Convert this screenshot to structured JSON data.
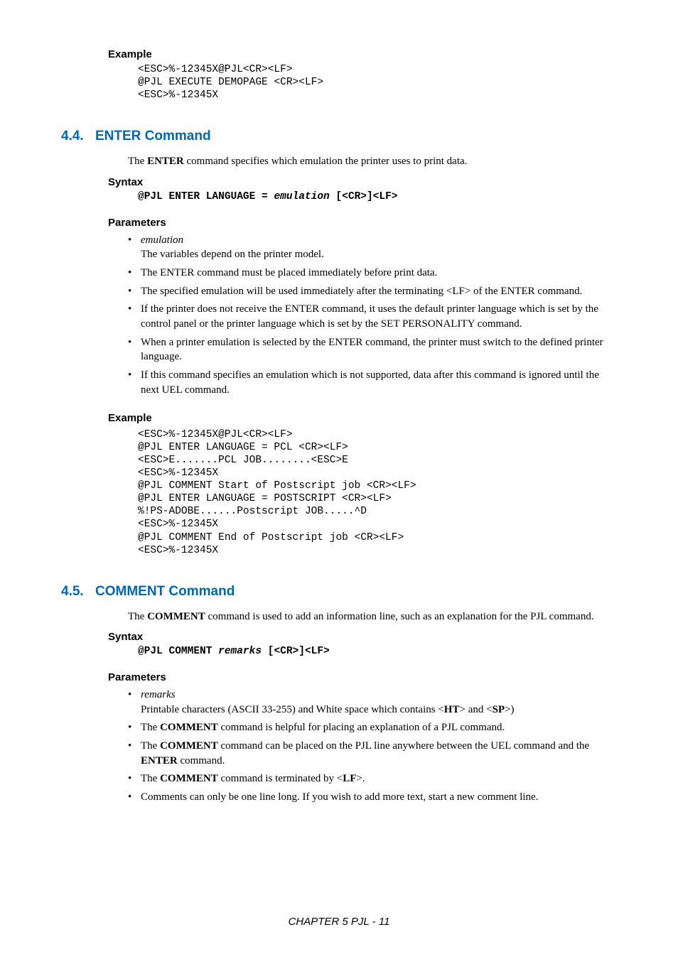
{
  "sec0": {
    "example_label": "Example",
    "example_code": "<ESC>%-12345X@PJL<CR><LF>\n@PJL EXECUTE DEMOPAGE <CR><LF>\n<ESC>%-12345X"
  },
  "sec44": {
    "num": "4.4.",
    "title": "ENTER Command",
    "intro_pre": "The ",
    "intro_bold": "ENTER",
    "intro_post": " command specifies which emulation the printer uses to print data.",
    "syntax_label": "Syntax",
    "syntax_code_pre": "@PJL ENTER LANGUAGE = ",
    "syntax_code_em": "emulation",
    "syntax_code_post": " [<CR>]<LF>",
    "params_label": "Parameters",
    "params": {
      "p0_em": "emulation",
      "p0_line2": "The variables depend on the printer model.",
      "p1": "The ENTER command must be placed immediately before print data.",
      "p2": "The specified emulation will be used immediately after  the terminating <LF> of the ENTER command.",
      "p3": "If the printer does not receive the ENTER command, it uses the default printer language which is set by the control panel or the printer language which is set by the SET PERSONALITY command.",
      "p4": "When a printer emulation is selected by the ENTER command, the printer must switch to the defined printer language.",
      "p5": "If this command specifies an emulation which is not supported,  data after this command is ignored until the next UEL command."
    },
    "example_label": "Example",
    "example_code": "<ESC>%-12345X@PJL<CR><LF>\n@PJL ENTER LANGUAGE = PCL <CR><LF>\n<ESC>E.......PCL JOB........<ESC>E\n<ESC>%-12345X\n@PJL COMMENT Start of Postscript job <CR><LF>\n@PJL ENTER LANGUAGE = POSTSCRIPT <CR><LF>\n%!PS-ADOBE......Postscript JOB.....^D\n<ESC>%-12345X\n@PJL COMMENT End of Postscript job <CR><LF>\n<ESC>%-12345X"
  },
  "sec45": {
    "num": "4.5.",
    "title": "COMMENT Command",
    "intro_pre": "The ",
    "intro_bold": "COMMENT",
    "intro_post": " command is used to add an information line, such as an explanation for the PJL command.",
    "syntax_label": "Syntax",
    "syntax_code_pre": "@PJL COMMENT ",
    "syntax_code_em": "remarks",
    "syntax_code_post": " [<CR>]<LF>",
    "params_label": "Parameters",
    "params": {
      "p0_em": "remarks",
      "p0_line2_a": "Printable characters (ASCII 33-255) and White space which contains <",
      "p0_line2_b1": "HT",
      "p0_line2_c": "> and <",
      "p0_line2_b2": "SP",
      "p0_line2_d": ">)",
      "p1_a": "The ",
      "p1_b": "COMMENT",
      "p1_c": " command is helpful for placing an explanation of a PJL command.",
      "p2_a": "The ",
      "p2_b": "COMMENT",
      "p2_c": " command can be placed on the PJL line anywhere between the UEL command and the ",
      "p2_d": "ENTER",
      "p2_e": " command.",
      "p3_a": "The ",
      "p3_b": "COMMENT",
      "p3_c": " command is terminated by <",
      "p3_d": "LF",
      "p3_e": ">.",
      "p4": "Comments can only be one line long. If you wish to add more text, start a new comment line."
    }
  },
  "footer": "CHAPTER 5 PJL - 11"
}
